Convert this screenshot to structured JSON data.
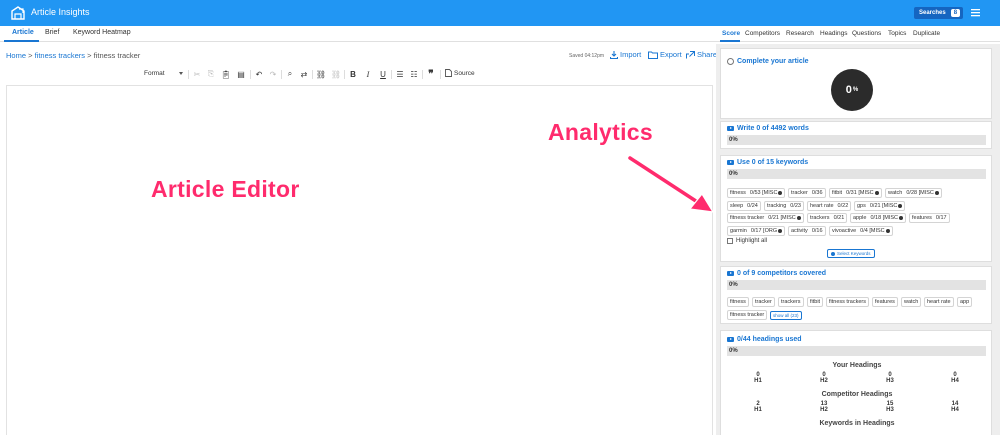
{
  "app": {
    "title": "Article Insights",
    "searches_label": "Searches",
    "searches_count": "8"
  },
  "left_tabs": [
    "Article",
    "Brief",
    "Keyword Heatmap"
  ],
  "right_tabs": [
    "Score",
    "Competitors",
    "Research",
    "Headings",
    "Questions",
    "Topics",
    "Duplicate"
  ],
  "breadcrumb": {
    "home": "Home",
    "sep": ">",
    "category": "fitness trackers",
    "current": "fitness tracker"
  },
  "status": {
    "saved": "Saved 04:12pm"
  },
  "actions": {
    "import": "Import",
    "export": "Export",
    "share": "Share"
  },
  "toolbar": {
    "format": "Format",
    "source": "Source"
  },
  "annotations": {
    "editor": "Article Editor",
    "analytics": "Analytics"
  },
  "score_card": {
    "title": "Complete your article",
    "score": "0",
    "score_unit": "%"
  },
  "words_card": {
    "title": "Write 0 of 4492 words",
    "progress_text": "0%",
    "progress": 0
  },
  "keywords_card": {
    "title": "Use 0 of 15 keywords",
    "progress_text": "0%",
    "progress": 0,
    "chips": [
      {
        "kw": "fitness",
        "val": "0/53",
        "tag": "[MISC"
      },
      {
        "kw": "tracker",
        "val": "0/36",
        "tag": ""
      },
      {
        "kw": "fitbit",
        "val": "0/31",
        "tag": "[MISC"
      },
      {
        "kw": "watch",
        "val": "0/28",
        "tag": "[MISC"
      },
      {
        "kw": "sleep",
        "val": "0/24",
        "tag": ""
      },
      {
        "kw": "tracking",
        "val": "0/23",
        "tag": ""
      },
      {
        "kw": "heart rate",
        "val": "0/22",
        "tag": ""
      },
      {
        "kw": "gps",
        "val": "0/21",
        "tag": "[MISC"
      },
      {
        "kw": "fitness tracker",
        "val": "0/21",
        "tag": "[MISC"
      },
      {
        "kw": "trackers",
        "val": "0/21",
        "tag": ""
      },
      {
        "kw": "apple",
        "val": "0/18",
        "tag": "[MISC"
      },
      {
        "kw": "features",
        "val": "0/17",
        "tag": ""
      },
      {
        "kw": "garmin",
        "val": "0/17",
        "tag": "[ORG"
      },
      {
        "kw": "activity",
        "val": "0/16",
        "tag": ""
      },
      {
        "kw": "vivoactive",
        "val": "0/4",
        "tag": "[MISC"
      }
    ],
    "highlight_all": "Highlight all",
    "select_button": "Select Keywords"
  },
  "competitors_card": {
    "title": "0 of 9 competitors covered",
    "progress_text": "0%",
    "progress": 0,
    "chips": [
      "fitness",
      "tracker",
      "trackers",
      "fitbit",
      "fitness trackers",
      "features",
      "watch",
      "heart rate",
      "app",
      "fitness tracker"
    ],
    "show_all": "show all (23)"
  },
  "headings_card": {
    "title": "0/44 headings used",
    "progress_text": "0%",
    "progress": 0,
    "your_headings_title": "Your Headings",
    "your_headings": [
      {
        "count": "0",
        "level": "H1"
      },
      {
        "count": "0",
        "level": "H2"
      },
      {
        "count": "0",
        "level": "H3"
      },
      {
        "count": "0",
        "level": "H4"
      }
    ],
    "competitor_headings_title": "Competitor Headings",
    "competitor_headings": [
      {
        "count": "2",
        "level": "H1"
      },
      {
        "count": "13",
        "level": "H2"
      },
      {
        "count": "15",
        "level": "H3"
      },
      {
        "count": "14",
        "level": "H4"
      }
    ],
    "keywords_in_headings_title": "Keywords in Headings"
  },
  "colors": {
    "brand": "#2196f3",
    "link": "#1976d2",
    "annotation": "#ff2b6d",
    "score_bg": "#2b2b2b"
  },
  "icons": [
    "app-logo-icon",
    "menu-icon",
    "import-icon",
    "export-icon",
    "share-icon",
    "radio-circle-icon",
    "play-icon",
    "person-icon"
  ]
}
